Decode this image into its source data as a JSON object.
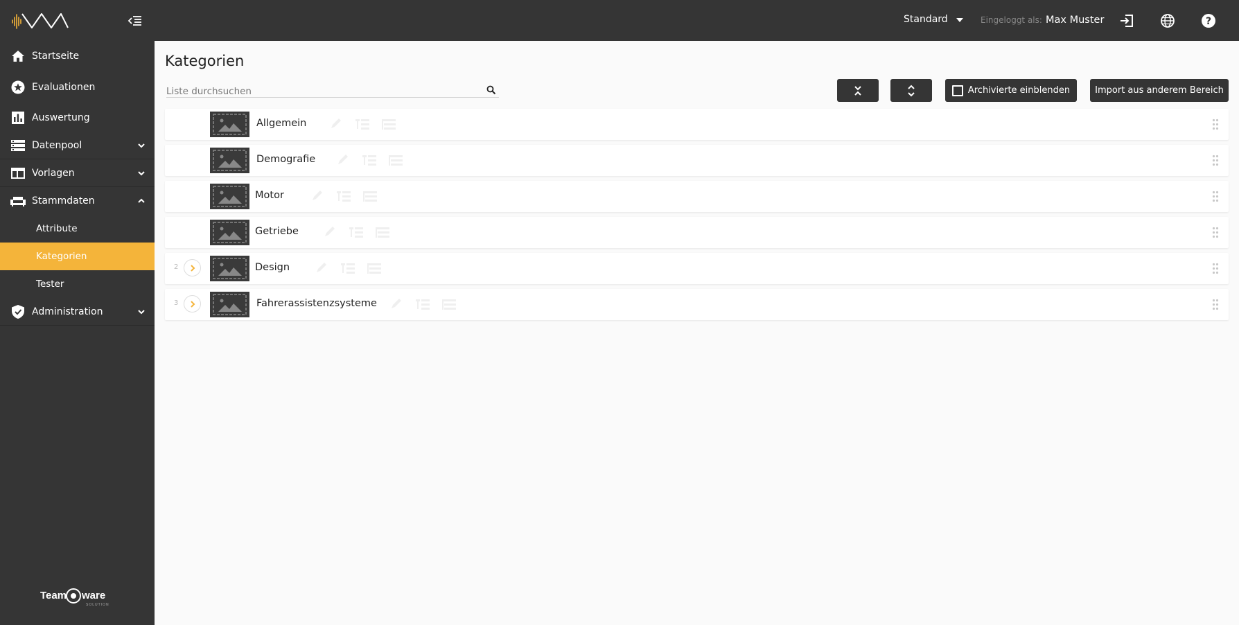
{
  "brand": {
    "logo": "wave-logo",
    "footer_logo": "Team ware",
    "footer_sub": "SOLUTIONS"
  },
  "sidebar": {
    "items": [
      {
        "label": "Startseite",
        "icon": "home-icon"
      },
      {
        "label": "Evaluationen",
        "icon": "star-circle-icon"
      },
      {
        "label": "Auswertung",
        "icon": "bar-chart-icon"
      },
      {
        "label": "Datenpool",
        "icon": "storage-icon",
        "expanded": false
      },
      {
        "label": "Vorlagen",
        "icon": "template-icon",
        "expanded": false
      },
      {
        "label": "Stammdaten",
        "icon": "sofa-icon",
        "expanded": true
      },
      {
        "label": "Administration",
        "icon": "shield-check-icon",
        "expanded": false
      }
    ],
    "sub_items": [
      {
        "label": "Attribute",
        "active": false
      },
      {
        "label": "Kategorien",
        "active": true
      },
      {
        "label": "Tester",
        "active": false
      }
    ]
  },
  "topbar": {
    "view_select": "Standard",
    "logged_in_label": "Eingeloggt als:",
    "user_name": "Max Muster",
    "icons": [
      "logout-icon",
      "globe-icon",
      "help-icon"
    ]
  },
  "main": {
    "title": "Kategorien",
    "search": {
      "placeholder": "Liste durchsuchen",
      "value": ""
    },
    "buttons": {
      "collapse_all": "collapse-all-icon",
      "expand_all": "expand-all-icon",
      "show_archived": "Archivierte einblenden",
      "import": "Import aus anderem Bereich"
    },
    "rows": [
      {
        "label": "Allgemein",
        "num": "",
        "expandable": false
      },
      {
        "label": "Demografie",
        "num": "",
        "expandable": false
      },
      {
        "label": "Motor",
        "num": "",
        "expandable": false
      },
      {
        "label": "Getriebe",
        "num": "",
        "expandable": false
      },
      {
        "label": "Design",
        "num": "2",
        "expandable": true
      },
      {
        "label": "Fahrerassistenzsysteme",
        "num": "3",
        "expandable": true
      }
    ]
  },
  "colors": {
    "dark": "#353535",
    "accent": "#f4b43a",
    "background": "#fafafa"
  }
}
